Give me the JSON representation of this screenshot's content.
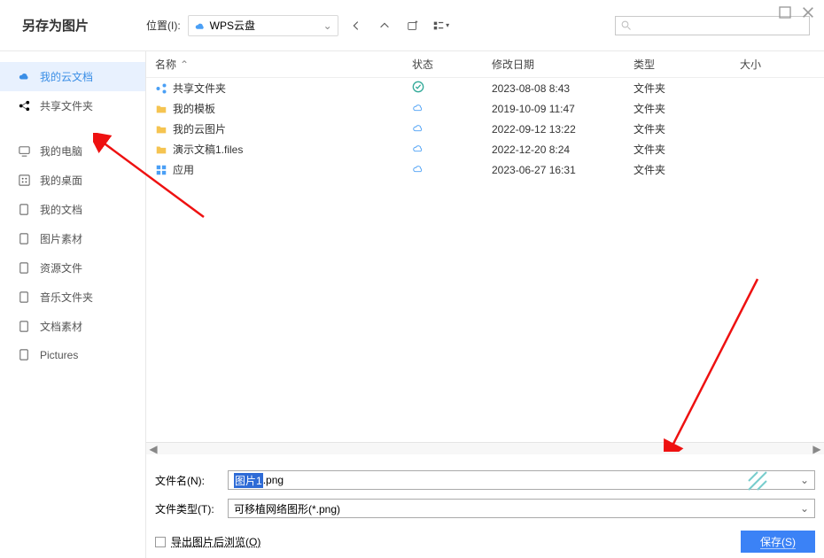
{
  "window": {
    "title": "另存为图片"
  },
  "location": {
    "label": "位置(I):",
    "value": "WPS云盘"
  },
  "search": {
    "placeholder": ""
  },
  "sidebar": {
    "group1": [
      {
        "label": "我的云文档",
        "icon": "cloud"
      },
      {
        "label": "共享文件夹",
        "icon": "share"
      }
    ],
    "group2": [
      {
        "label": "我的电脑",
        "icon": "screen"
      },
      {
        "label": "我的桌面",
        "icon": "dots"
      },
      {
        "label": "我的文档",
        "icon": "doc"
      },
      {
        "label": "图片素材",
        "icon": "doc"
      },
      {
        "label": "资源文件",
        "icon": "doc"
      },
      {
        "label": "音乐文件夹",
        "icon": "doc"
      },
      {
        "label": "文档素材",
        "icon": "doc"
      },
      {
        "label": "Pictures",
        "icon": "doc"
      }
    ]
  },
  "columns": {
    "name": "名称",
    "status": "状态",
    "date": "修改日期",
    "type": "类型",
    "size": "大小"
  },
  "files": [
    {
      "name": "共享文件夹",
      "icon": "share-blue",
      "status": "check",
      "date": "2023-08-08 8:43",
      "type": "文件夹"
    },
    {
      "name": "我的模板",
      "icon": "folder",
      "status": "cloud",
      "date": "2019-10-09 11:47",
      "type": "文件夹"
    },
    {
      "name": "我的云图片",
      "icon": "folder",
      "status": "cloud",
      "date": "2022-09-12 13:22",
      "type": "文件夹"
    },
    {
      "name": "演示文稿1.files",
      "icon": "folder",
      "status": "cloud",
      "date": "2022-12-20 8:24",
      "type": "文件夹"
    },
    {
      "name": "应用",
      "icon": "apps",
      "status": "cloud",
      "date": "2023-06-27 16:31",
      "type": "文件夹"
    }
  ],
  "form": {
    "filename_label": "文件名(N):",
    "filename_value_sel": "图片1",
    "filename_value_ext": ".png",
    "filetype_label": "文件类型(T):",
    "filetype_value": "可移植网络图形(*.png)"
  },
  "actions": {
    "export_browse": "导出图片后浏览(O)",
    "save": "保存(S)"
  }
}
